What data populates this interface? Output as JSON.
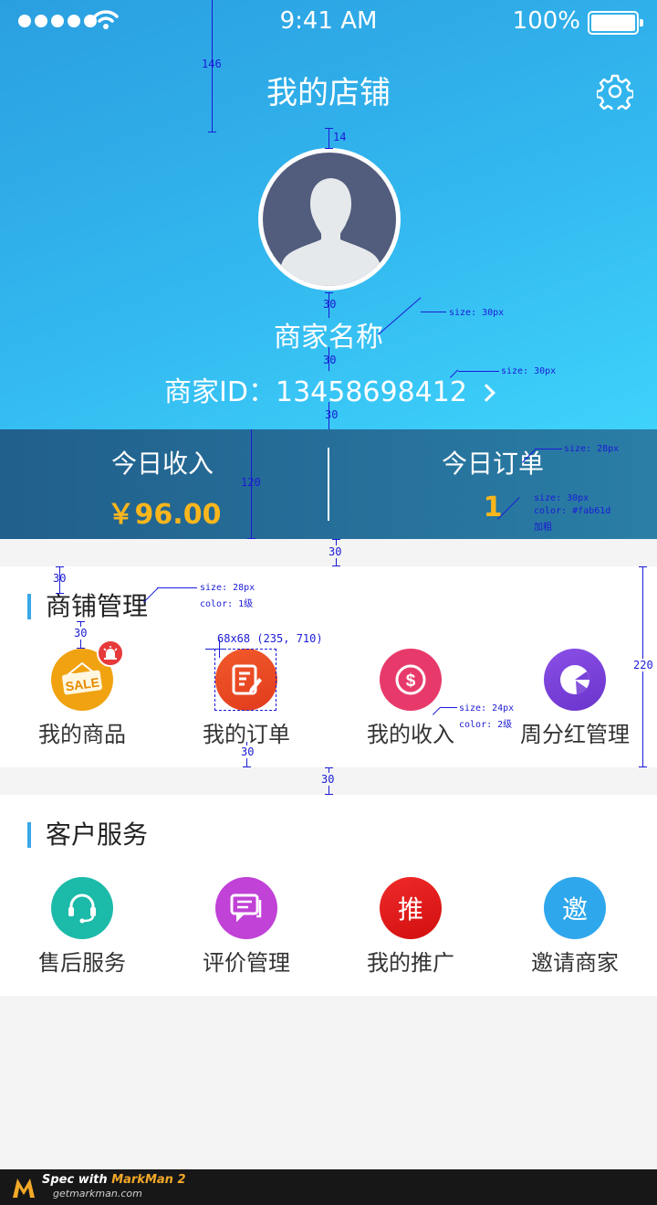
{
  "status_bar": {
    "time": "9:41 AM",
    "battery_percent": "100%"
  },
  "header": {
    "title": "我的店铺",
    "merchant_name": "商家名称",
    "merchant_id_label": "商家ID：",
    "merchant_id": "13458698412"
  },
  "stats": {
    "income_label": "今日收入",
    "income_value": "￥96.00",
    "orders_label": "今日订单",
    "orders_value": "1",
    "value_color": "#fab61d"
  },
  "shop_management": {
    "title": "商铺管理",
    "items": [
      {
        "label": "我的商品",
        "icon": "sale-tag-icon",
        "color": "#f0a211"
      },
      {
        "label": "我的订单",
        "icon": "order-edit-icon",
        "color": "#ee4a23"
      },
      {
        "label": "我的收入",
        "icon": "dollar-icon",
        "color": "#e73a6a"
      },
      {
        "label": "周分红管理",
        "icon": "pie-chart-icon",
        "color": "#7a43d8"
      }
    ]
  },
  "customer_service": {
    "title": "客户服务",
    "items": [
      {
        "label": "售后服务",
        "icon": "headset-icon",
        "color": "#1cbaa9"
      },
      {
        "label": "评价管理",
        "icon": "chat-bubble-icon",
        "color": "#c042d6"
      },
      {
        "label": "我的推广",
        "icon": "promote-icon",
        "glyph": "推",
        "color": "#e51818"
      },
      {
        "label": "邀请商家",
        "icon": "invite-icon",
        "glyph": "邀",
        "color": "#2fa7ec"
      }
    ]
  },
  "annotations": {
    "header_gap": "146",
    "avatar_gap": "14",
    "name_gap": "30",
    "id_gap": "30",
    "stats_gap": "30",
    "stats_height": "120",
    "section_gap": "30",
    "title_left": "30",
    "title_bottom": "30",
    "section_height": "220",
    "label_bottom": "30",
    "section_gap2": "30",
    "name_spec": "size: 30px",
    "id_spec": "size: 30px",
    "orders_label_spec": "size: 28px",
    "orders_value_spec_1": "size: 30px",
    "orders_value_spec_2": "color: #fab61d",
    "orders_value_spec_3": "加粗",
    "title_spec_1": "size: 28px",
    "title_spec_2": "color: 1级",
    "icon_box_spec": "68x68 (235, 710)",
    "label_spec_1": "size: 24px",
    "label_spec_2": "color: 2级"
  },
  "footer": {
    "line1_prefix": "Spec with",
    "line1_brand": "MarkMan 2",
    "line2": "getmarkman.com"
  }
}
